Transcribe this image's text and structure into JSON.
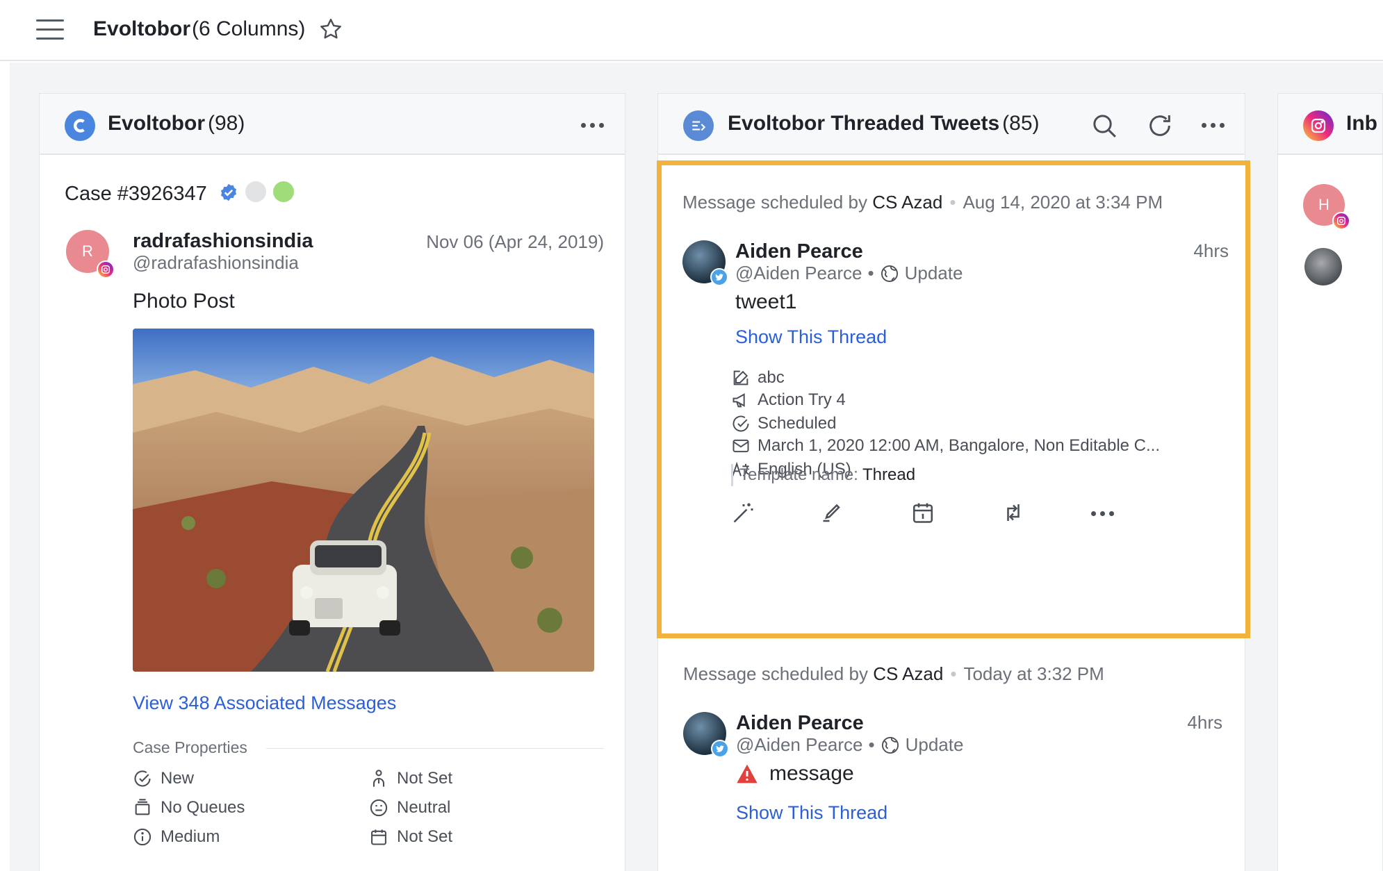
{
  "header": {
    "title": "Evoltobor",
    "subtitle": "(6 Columns)"
  },
  "columns": [
    {
      "title": "Evoltobor",
      "count": "(98)",
      "case": {
        "id": "Case #3926347",
        "author_name": "radrafashionsindia",
        "author_handle": "@radrafashionsindia",
        "avatar_letter": "R",
        "date": "Nov 06 (Apr 24, 2019)",
        "post_type": "Photo Post",
        "associated_link": "View 348 Associated Messages",
        "properties_title": "Case Properties",
        "properties": [
          "New",
          "Not Set",
          "No Queues",
          "Neutral",
          "Medium",
          "Not Set"
        ]
      }
    },
    {
      "title": "Evoltobor Threaded Tweets",
      "count": "(85)",
      "messages": [
        {
          "sched_prefix": "Message scheduled by",
          "sched_by": "CS Azad",
          "sched_time": "Aug 14, 2020 at 3:34 PM",
          "name": "Aiden Pearce",
          "handle": "@Aiden Pearce",
          "handle_sep": "•",
          "update": "Update",
          "time": "4hrs",
          "text": "tweet1",
          "thread_link": "Show This Thread",
          "meta": {
            "note": "abc",
            "campaign": "Action Try 4",
            "status": "Scheduled",
            "schedule": "March 1, 2020 12:00 AM, Bangalore, Non Editable C...",
            "language": "English (US)",
            "template_label": "Template name:",
            "template_value": "Thread"
          }
        },
        {
          "sched_prefix": "Message scheduled by",
          "sched_by": "CS Azad",
          "sched_time": "Today at 3:32 PM",
          "name": "Aiden Pearce",
          "handle": "@Aiden Pearce",
          "handle_sep": "•",
          "update": "Update",
          "time": "4hrs",
          "text": "message",
          "thread_link": "Show This Thread"
        }
      ]
    },
    {
      "title": "Inb",
      "avatar_letter": "H"
    }
  ],
  "colors": {
    "accent_link": "#2b5fd9",
    "highlight": "#f0b43c",
    "twitter": "#4aa3e8",
    "warning": "#e0413c"
  },
  "icons": [
    "hamburger-icon",
    "star-icon",
    "search-icon",
    "refresh-icon",
    "more-icon",
    "edit-icon",
    "megaphone-icon",
    "scheduled-icon",
    "mail-icon",
    "translate-icon",
    "magic-wand-icon",
    "pen-icon",
    "calendar-icon",
    "retweet-icon",
    "warning-icon"
  ]
}
